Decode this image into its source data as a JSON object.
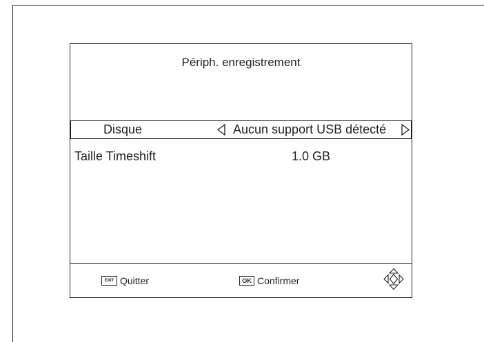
{
  "dialog": {
    "title": "Périph. enregistrement"
  },
  "rows": [
    {
      "label": "Disque",
      "value": "Aucun support USB détecté",
      "selected": true
    },
    {
      "label": "Taille Timeshift",
      "value": "1.0 GB",
      "selected": false
    }
  ],
  "footer": {
    "exit_key": "EXIT",
    "exit_label": "Quitter",
    "ok_key": "OK",
    "ok_label": "Confirmer",
    "nav_icon": "four-direction-navigation-icon"
  },
  "icons": {
    "left_arrow": "triangle-left-outline",
    "right_arrow": "triangle-right-outline"
  }
}
